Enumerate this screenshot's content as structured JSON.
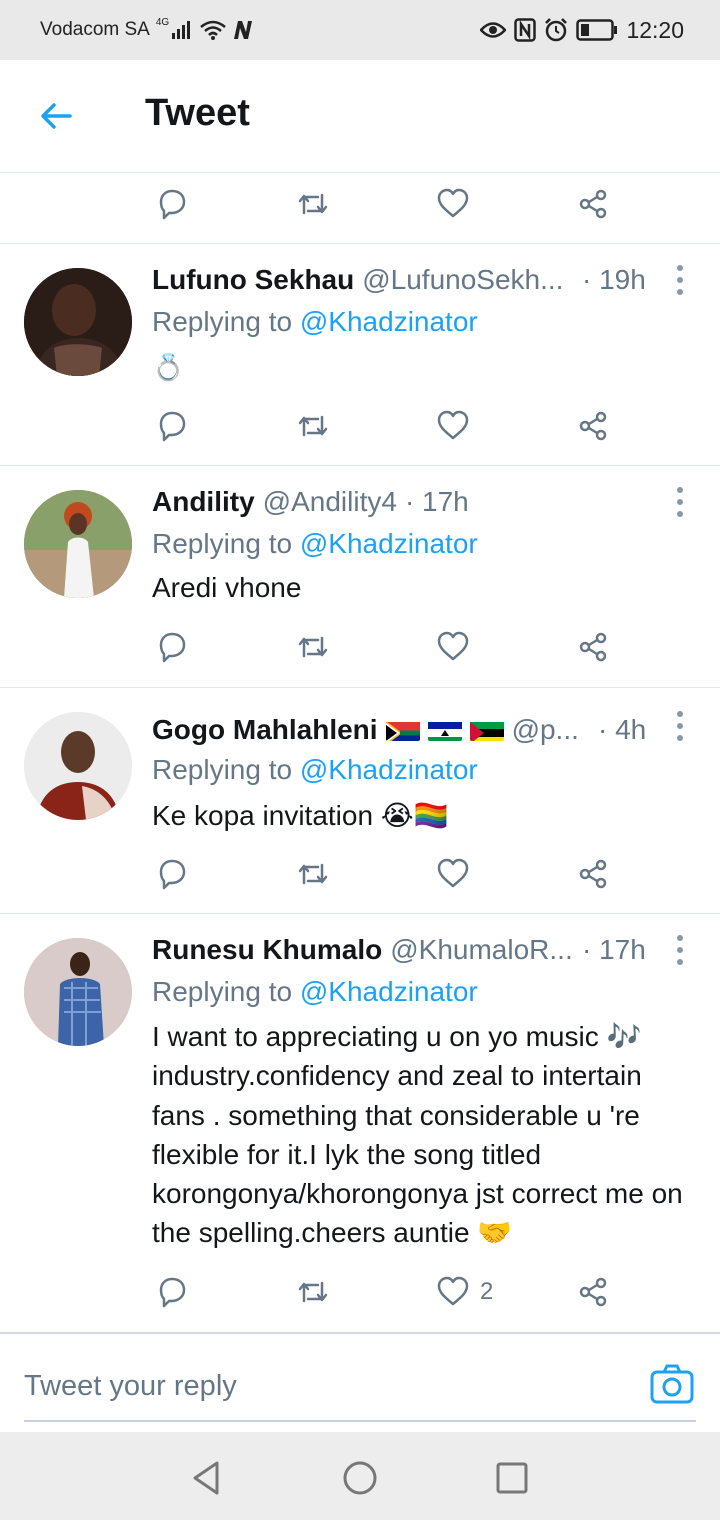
{
  "status_bar": {
    "carrier": "Vodacom SA",
    "network_type": "4G",
    "time": "12:20",
    "icons": [
      "signal-icon",
      "wifi-icon",
      "n-icon",
      "eye-icon",
      "nfc-icon",
      "alarm-icon",
      "battery-icon"
    ]
  },
  "app_bar": {
    "title": "Tweet",
    "back_icon": "arrow-left-icon",
    "accent_color": "#1da1f2"
  },
  "tweets": [
    {
      "name": "Lufuno Sekhau",
      "handle": "@LufunoSekh...",
      "time": "· 19h",
      "replying_prefix": "Replying to ",
      "replying_to": "@Khadzinator",
      "body": "💍"
    },
    {
      "name": "Andility",
      "handle": "@Andility4",
      "time": "· 17h",
      "replying_prefix": "Replying to ",
      "replying_to": "@Khadzinator",
      "body": "Aredi vhone"
    },
    {
      "name": "Gogo Mahlahleni",
      "name_flags": [
        "south-africa-flag",
        "lesotho-flag",
        "mozambique-flag"
      ],
      "handle": "@p...",
      "time": "· 4h",
      "replying_prefix": "Replying to ",
      "replying_to": "@Khadzinator",
      "body": "Ke kopa invitation 😭🏳️‍🌈"
    },
    {
      "name": "Runesu Khumalo",
      "handle": "@KhumaloR...",
      "time": "· 17h",
      "replying_prefix": "Replying to ",
      "replying_to": "@Khadzinator",
      "body": "I want to appreciating u on yo music 🎶 industry.confidency and zeal to intertain fans . something that considerable u 're flexible for it.I lyk the song titled korongonya/khorongonya jst correct me on the spelling.cheers auntie 🤝",
      "like_count": "2"
    }
  ],
  "composer": {
    "placeholder": "Tweet your reply",
    "camera_icon": "camera-icon"
  },
  "nav_bar": {
    "icons": [
      "back-triangle-icon",
      "home-circle-icon",
      "recents-square-icon"
    ]
  }
}
